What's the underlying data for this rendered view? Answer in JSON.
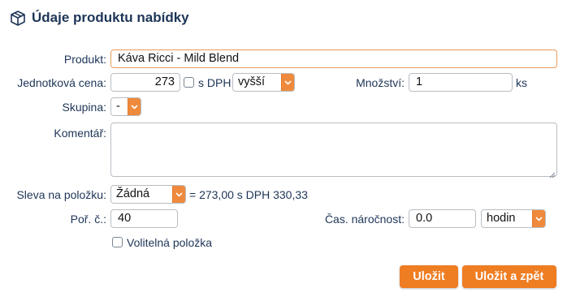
{
  "header": {
    "title": "Údaje produktu nabídky",
    "icon": "box-icon"
  },
  "form": {
    "product": {
      "label": "Produkt:",
      "value": "Káva Ricci - Mild Blend"
    },
    "unit_price": {
      "label": "Jednotková cena:",
      "value": "273",
      "vat_checkbox_label": "s DPH",
      "vat_checkbox_checked": false,
      "vat_rate_selected": "vyšší"
    },
    "quantity": {
      "label": "Množství:",
      "value": "1",
      "unit": "ks"
    },
    "group": {
      "label": "Skupina:",
      "selected": "-"
    },
    "comment": {
      "label": "Komentář:",
      "value": ""
    },
    "discount": {
      "label": "Sleva na položku:",
      "selected": "Žádná",
      "summary": "= 273,00 s DPH 330,33"
    },
    "order_no": {
      "label": "Poř. č.:",
      "value": "40"
    },
    "time_demand": {
      "label": "Čas. náročnost:",
      "value": "0.0",
      "unit_selected": "hodin"
    },
    "optional": {
      "label": "Volitelná položka",
      "checked": false
    }
  },
  "actions": {
    "save": "Uložit",
    "save_back": "Uložit a zpět"
  },
  "colors": {
    "accent": "#ef7d22",
    "text": "#1d3557",
    "border": "#b8bec4"
  }
}
